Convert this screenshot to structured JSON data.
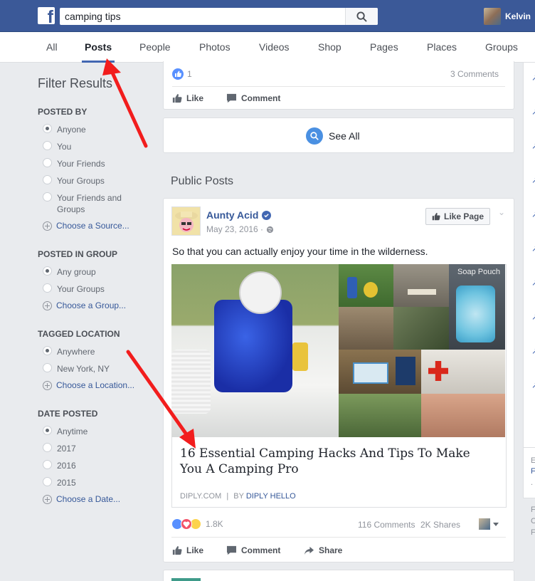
{
  "header": {
    "logo_glyph": "f",
    "search_value": "camping tips",
    "user_name": "Kelvin"
  },
  "tabs": [
    "All",
    "Posts",
    "People",
    "Photos",
    "Videos",
    "Shop",
    "Pages",
    "Places",
    "Groups"
  ],
  "active_tab": "Posts",
  "filters": {
    "title": "Filter Results",
    "posted_by": {
      "heading": "POSTED BY",
      "options": [
        "Anyone",
        "You",
        "Your Friends",
        "Your Groups",
        "Your Friends and Groups"
      ],
      "selected": "Anyone",
      "choose": "Choose a Source..."
    },
    "posted_in_group": {
      "heading": "POSTED IN GROUP",
      "options": [
        "Any group",
        "Your Groups"
      ],
      "selected": "Any group",
      "choose": "Choose a Group..."
    },
    "tagged_location": {
      "heading": "TAGGED LOCATION",
      "options": [
        "Anywhere",
        "New York, NY"
      ],
      "selected": "Anywhere",
      "choose": "Choose a Location..."
    },
    "date_posted": {
      "heading": "DATE POSTED",
      "options": [
        "Anytime",
        "2017",
        "2016",
        "2015"
      ],
      "selected": "Anytime",
      "choose": "Choose a Date..."
    }
  },
  "prev_post": {
    "like_count": "1",
    "comments": "3 Comments",
    "like_label": "Like",
    "comment_label": "Comment"
  },
  "see_all": "See All",
  "public_posts_heading": "Public Posts",
  "post": {
    "author": "Aunty Acid",
    "date": "May 23, 2016 ·",
    "like_page_label": "Like Page",
    "text": "So that you can actually enjoy your time in the wilderness.",
    "link_title": "16 Essential Camping Hacks And Tips To Make You A Camping Pro",
    "link_source": "DIPLY.COM",
    "link_by_prefix": "BY",
    "link_by": "DIPLY HELLO",
    "image_caption_soap": "Soap Pouch",
    "reaction_count": "1.8K",
    "comments": "116 Comments",
    "shares": "2K Shares",
    "like_label": "Like",
    "comment_label": "Comment",
    "share_label": "Share"
  },
  "right_column": {
    "letters": [
      "E",
      "F",
      ".",
      "F",
      "C",
      "F"
    ]
  },
  "colors": {
    "fb_blue": "#3b5998",
    "link_blue": "#365899",
    "accent": "#4267b2",
    "annotation_red": "#f21d1d"
  }
}
